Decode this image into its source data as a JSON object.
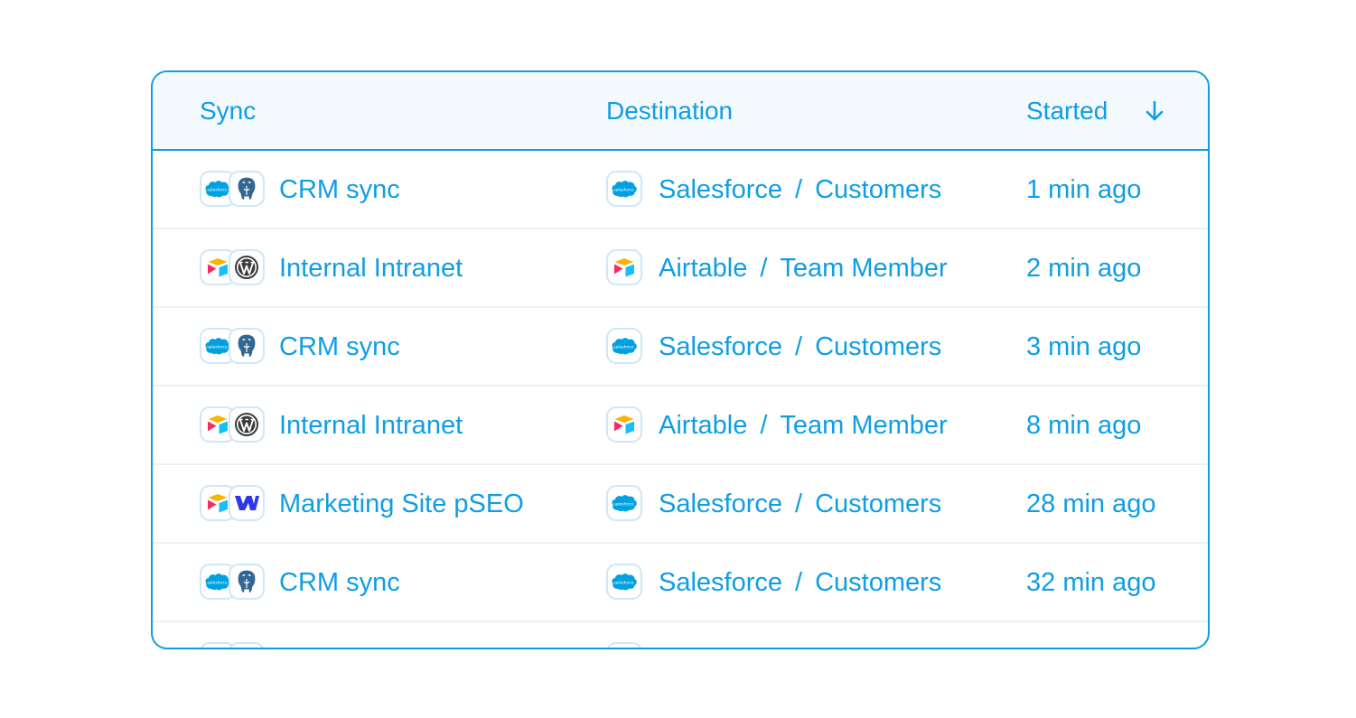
{
  "columns": {
    "sync": "Sync",
    "destination": "Destination",
    "started": "Started"
  },
  "sort": {
    "column": "started",
    "direction": "descending",
    "icon": "arrow-down-icon"
  },
  "rows": [
    {
      "sync_name": "CRM sync",
      "source_icons": [
        "salesforce-icon",
        "postgresql-icon"
      ],
      "dest_icon": "salesforce-icon",
      "dest_app": "Salesforce",
      "dest_sep": "/",
      "dest_object": "Customers",
      "started": "1 min ago"
    },
    {
      "sync_name": "Internal Intranet",
      "source_icons": [
        "airtable-icon",
        "wordpress-icon"
      ],
      "dest_icon": "airtable-icon",
      "dest_app": "Airtable",
      "dest_sep": "/",
      "dest_object": "Team Member",
      "started": "2 min ago"
    },
    {
      "sync_name": "CRM sync",
      "source_icons": [
        "salesforce-icon",
        "postgresql-icon"
      ],
      "dest_icon": "salesforce-icon",
      "dest_app": "Salesforce",
      "dest_sep": "/",
      "dest_object": "Customers",
      "started": "3 min ago"
    },
    {
      "sync_name": "Internal Intranet",
      "source_icons": [
        "airtable-icon",
        "wordpress-icon"
      ],
      "dest_icon": "airtable-icon",
      "dest_app": "Airtable",
      "dest_sep": "/",
      "dest_object": "Team Member",
      "started": "8 min ago"
    },
    {
      "sync_name": "Marketing Site pSEO",
      "source_icons": [
        "airtable-icon",
        "webflow-icon"
      ],
      "dest_icon": "salesforce-icon",
      "dest_app": "Salesforce",
      "dest_sep": "/",
      "dest_object": "Customers",
      "started": "28 min ago"
    },
    {
      "sync_name": "CRM sync",
      "source_icons": [
        "salesforce-icon",
        "postgresql-icon"
      ],
      "dest_icon": "salesforce-icon",
      "dest_app": "Salesforce",
      "dest_sep": "/",
      "dest_object": "Customers",
      "started": "32 min ago"
    }
  ],
  "colors": {
    "accent": "#0f9ee3",
    "header_bg": "#f4f9fd",
    "row_divider": "#eef1f4",
    "icon_border": "#cfe7f6"
  }
}
